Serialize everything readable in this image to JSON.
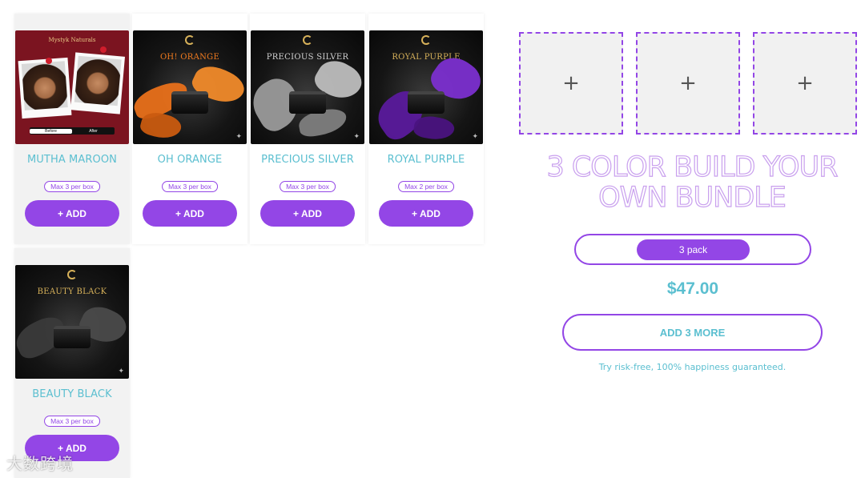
{
  "products": [
    {
      "name": "MUTHA MAROON",
      "max": "Max 3 per box",
      "add": "+ ADD",
      "brand": "Mystyk Naturals",
      "before": "Before",
      "after": "After"
    },
    {
      "name": "OH ORANGE",
      "max": "Max 3 per box",
      "add": "+ ADD",
      "photo_title": "OH! ORANGE",
      "accent": "#f07a1e"
    },
    {
      "name": "PRECIOUS SILVER",
      "max": "Max 3 per box",
      "add": "+ ADD",
      "photo_title": "PRECIOUS SILVER",
      "accent": "#c8c8c8"
    },
    {
      "name": "ROYAL PURPLE",
      "max": "Max 2 per box",
      "add": "+ ADD",
      "photo_title": "ROYAL PURPLE",
      "accent": "#6a1fb0"
    },
    {
      "name": "BEAUTY BLACK",
      "max": "Max 3 per box",
      "add": "+ ADD",
      "photo_title": "BEAUTY BLACK",
      "accent": "#2a2a2a"
    }
  ],
  "bundle": {
    "slot_symbol": "+",
    "title": "3 COLOR BUILD YOUR OWN BUNDLE",
    "pack_label": "3 pack",
    "price": "$47.00",
    "add_more_label": "ADD 3 MORE",
    "guarantee": "Try risk-free, 100% happiness guaranteed."
  },
  "watermark": "大数跨境",
  "colors": {
    "purple": "#9346e6",
    "teal": "#5bbfd0",
    "maroon": "#7b1420"
  }
}
